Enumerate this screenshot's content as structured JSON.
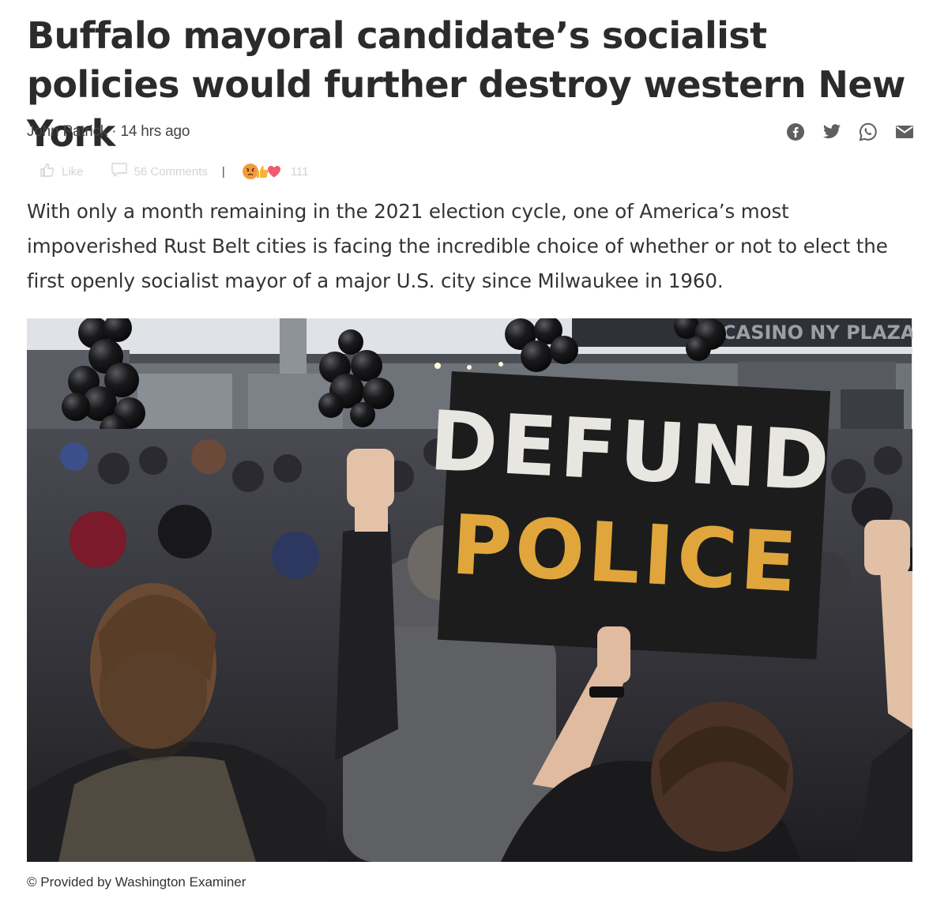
{
  "article": {
    "headline": "Buffalo mayoral candidate’s socialist policies would further destroy western New York",
    "author": "John Patrick",
    "separator": " · ",
    "time_ago": "14 hrs ago",
    "lede": "With only a month remaining in the 2021 election cycle, one of America’s most impoverished Rust Belt cities is facing the incredible choice of whether or not to elect the first openly socialist mayor of a major U.S. city since Milwaukee in 1960."
  },
  "share": {
    "icons": [
      "facebook-icon",
      "twitter-icon",
      "whatsapp-icon",
      "email-icon"
    ]
  },
  "engagement": {
    "like_label": "Like",
    "comments_label": "56 Comments",
    "divider": "|",
    "reaction_icons": [
      "angry-reaction-icon",
      "thumbs-up-reaction-icon",
      "heart-reaction-icon"
    ],
    "reaction_count": "111"
  },
  "image": {
    "sign_line1": "DEFUND",
    "sign_line2": "POLICE",
    "building_text": "CASINO NY PLAZA",
    "caption": "© Provided by Washington Examiner"
  },
  "colors": {
    "headline": "#2b2b2b",
    "sign_white": "#e8e6e0",
    "sign_gold": "#e0a63c",
    "sign_board": "#1c1c1c"
  }
}
